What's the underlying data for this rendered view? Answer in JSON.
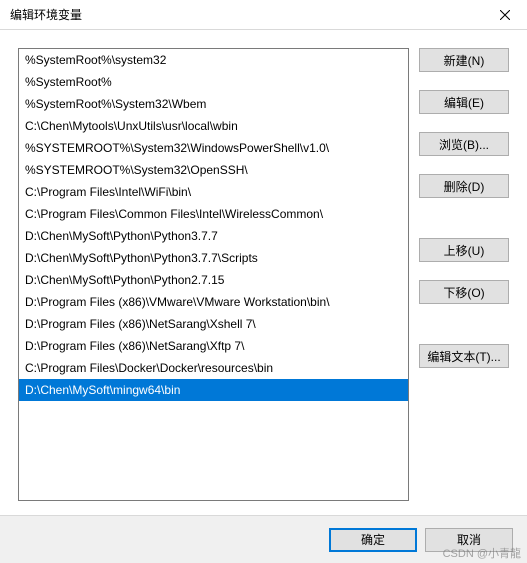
{
  "titlebar": {
    "title": "编辑环境变量"
  },
  "entries": [
    "%SystemRoot%\\system32",
    "%SystemRoot%",
    "%SystemRoot%\\System32\\Wbem",
    "C:\\Chen\\Mytools\\UnxUtils\\usr\\local\\wbin",
    "%SYSTEMROOT%\\System32\\WindowsPowerShell\\v1.0\\",
    "%SYSTEMROOT%\\System32\\OpenSSH\\",
    "C:\\Program Files\\Intel\\WiFi\\bin\\",
    "C:\\Program Files\\Common Files\\Intel\\WirelessCommon\\",
    "D:\\Chen\\MySoft\\Python\\Python3.7.7",
    "D:\\Chen\\MySoft\\Python\\Python3.7.7\\Scripts",
    "D:\\Chen\\MySoft\\Python\\Python2.7.15",
    "D:\\Program Files (x86)\\VMware\\VMware Workstation\\bin\\",
    "D:\\Program Files (x86)\\NetSarang\\Xshell 7\\",
    "D:\\Program Files (x86)\\NetSarang\\Xftp 7\\",
    "C:\\Program Files\\Docker\\Docker\\resources\\bin",
    "D:\\Chen\\MySoft\\mingw64\\bin"
  ],
  "selected_index": 15,
  "buttons": {
    "new": "新建(N)",
    "edit": "编辑(E)",
    "browse": "浏览(B)...",
    "delete": "删除(D)",
    "moveup": "上移(U)",
    "movedown": "下移(O)",
    "edittext": "编辑文本(T)..."
  },
  "footer": {
    "ok": "确定",
    "cancel": "取消"
  },
  "watermark": "CSDN @小青龍"
}
